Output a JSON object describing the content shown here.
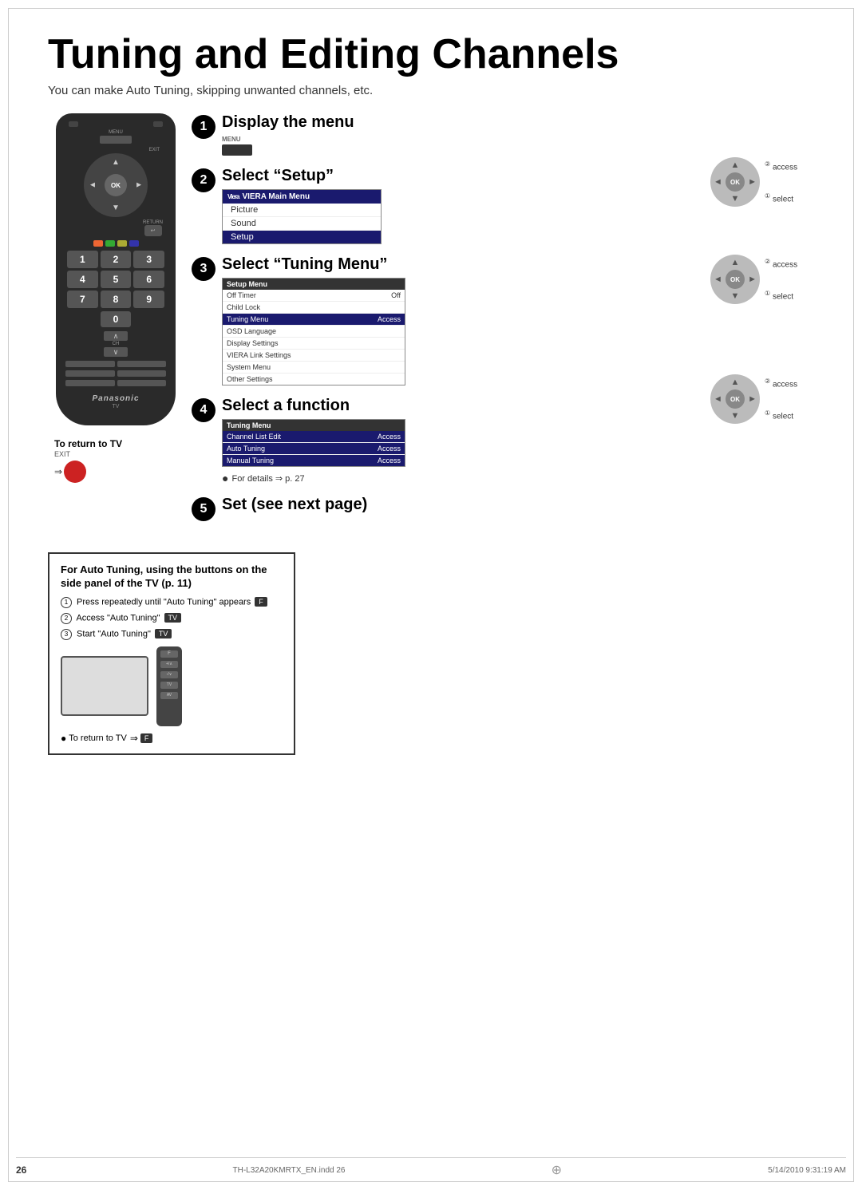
{
  "page": {
    "title": "Tuning and Editing Channels",
    "subtitle": "You can make Auto Tuning, skipping unwanted channels, etc.",
    "page_number": "26",
    "footer_file": "TH-L32A20KMRTX_EN.indd   26",
    "footer_date": "5/14/2010   9:31:19 AM"
  },
  "steps": [
    {
      "number": "1",
      "title": "Display the menu",
      "subtitle_label": "MENU",
      "key_label": "MENU"
    },
    {
      "number": "2",
      "title": "Select “Setup”",
      "menu_header": "VIERA Main Menu",
      "menu_items": [
        "Picture",
        "Sound",
        "Setup"
      ],
      "active_item": "Setup"
    },
    {
      "number": "3",
      "title": "Select “Tuning Menu”",
      "menu_header": "Setup Menu",
      "menu_rows": [
        {
          "label": "Off Timer",
          "value": "Off"
        },
        {
          "label": "Child Lock",
          "value": ""
        },
        {
          "label": "Tuning Menu",
          "value": "Access"
        },
        {
          "label": "OSD Language",
          "value": ""
        },
        {
          "label": "Display Settings",
          "value": ""
        },
        {
          "label": "VIERA Link Settings",
          "value": ""
        },
        {
          "label": "System Menu",
          "value": ""
        },
        {
          "label": "Other Settings",
          "value": ""
        }
      ],
      "active_row": "Tuning Menu"
    },
    {
      "number": "4",
      "title": "Select a function",
      "menu_header": "Tuning Menu",
      "menu_rows": [
        {
          "label": "Channel List Edit",
          "value": "Access"
        },
        {
          "label": "Auto Tuning",
          "value": "Access"
        },
        {
          "label": "Manual Tuning",
          "value": "Access"
        }
      ],
      "for_details": "For details ⇒ p. 27"
    },
    {
      "number": "5",
      "title": "Set (see next page)"
    }
  ],
  "ok_diagrams": [
    {
      "access_label": "② access",
      "select_label": "① select"
    },
    {
      "access_label": "② access",
      "select_label": "① select"
    },
    {
      "access_label": "② access",
      "select_label": "① select"
    }
  ],
  "return_to_tv": {
    "label": "To return to TV",
    "button_label": "EXIT"
  },
  "auto_tuning_box": {
    "title": "For Auto Tuning, using the buttons on the side panel of the TV (p. 11)",
    "steps": [
      {
        "num": "①",
        "text": "Press repeatedly until \"Auto Tuning\" appears",
        "key": "F"
      },
      {
        "num": "②",
        "text": "Access \"Auto Tuning\"",
        "key": "TV"
      },
      {
        "num": "③",
        "text": "Start \"Auto Tuning\"",
        "key": "TV"
      }
    ],
    "return_row": "To return to TV",
    "return_key": "F"
  },
  "numbers": [
    "1",
    "2",
    "3",
    "4",
    "5",
    "6",
    "7",
    "8",
    "9",
    "0"
  ],
  "remote": {
    "panasonic_label": "Panasonic",
    "tv_label": "TV",
    "ok_label": "OK",
    "menu_label": "MENU",
    "exit_label": "EXIT",
    "return_label": "RETURN",
    "ch_label": "CH"
  }
}
